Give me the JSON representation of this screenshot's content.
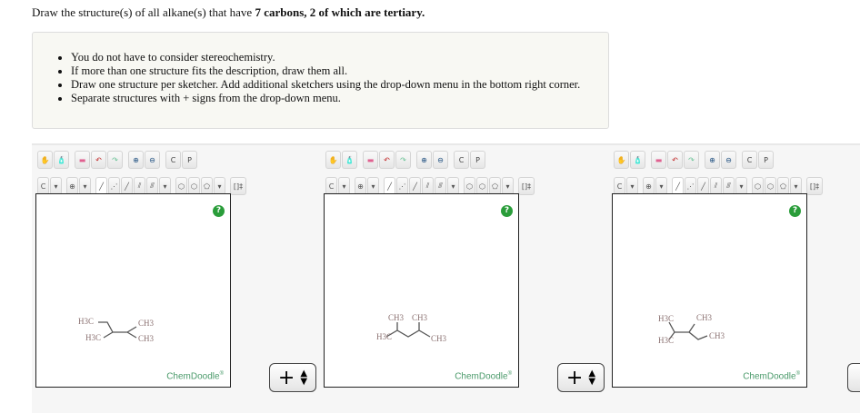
{
  "question": {
    "prefix": "Draw the structure(s) of all alkane(s) that have ",
    "bold": "7 carbons, 2 of which are tertiary."
  },
  "instructions": [
    "You do not have to consider stereochemistry.",
    "If more than one structure fits the description, draw them all.",
    "Draw one structure per sketcher. Add additional sketchers using the drop-down menu in the bottom right corner.",
    "Separate structures with + signs from the drop-down menu."
  ],
  "toolbar": {
    "row1": [
      "hand-icon",
      "eraser-bottle-icon",
      "eraser-icon",
      "undo-icon",
      "redo-icon",
      "zoom-in-icon",
      "zoom-out-icon",
      "copy-icon",
      "paste-icon"
    ],
    "copy_label": "C",
    "paste_label": "P",
    "element_label": "C",
    "bracket_label": "[]‡"
  },
  "help_label": "?",
  "brand": "ChemDoodle",
  "brand_mark": "®",
  "separator": {
    "symbol": "+"
  },
  "sketchers": [
    {
      "labels": [
        "H3C",
        "CH3",
        "H3C",
        "CH3"
      ]
    },
    {
      "labels": [
        "CH3",
        "CH3",
        "H3C",
        "CH3"
      ]
    },
    {
      "labels": [
        "H3C",
        "CH3",
        "CH3",
        "H3C"
      ]
    }
  ]
}
